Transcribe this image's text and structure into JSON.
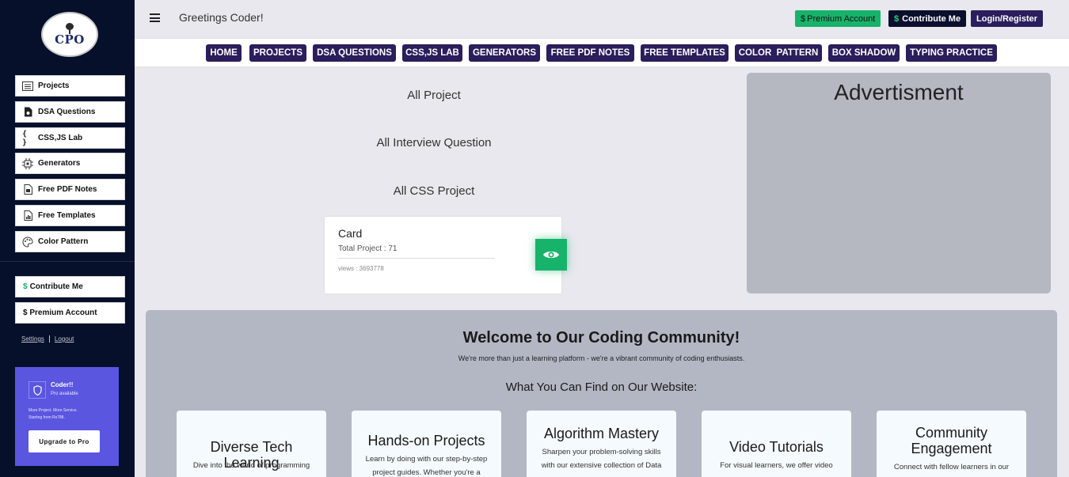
{
  "sidebar": {
    "logo_text": "CPO",
    "items": [
      {
        "label": "Projects",
        "icon": "list-icon"
      },
      {
        "label": "DSA Questions",
        "icon": "file-icon"
      },
      {
        "label": "CSS,JS Lab",
        "icon": "braces-icon"
      },
      {
        "label": "Generators",
        "icon": "chip-icon"
      },
      {
        "label": "Free PDF Notes",
        "icon": "pdf-icon"
      },
      {
        "label": "Free Templates",
        "icon": "template-icon"
      },
      {
        "label": "Color  Pattern",
        "icon": "palette-icon"
      }
    ],
    "contribute_label": "Contribute Me",
    "premium_label": "$ Premium Account",
    "settings_label": "Settings",
    "logout_label": "Logout",
    "promo": {
      "title": "Coder!!",
      "subtitle": "Pro available",
      "desc_line1": "More Project. More Service.",
      "desc_line2": "Starting from Rs788.",
      "button": "Upgrade to Pro"
    }
  },
  "header": {
    "greeting": "Greetings Coder!",
    "premium_label": "Premium Account",
    "contribute_label": "Contribute Me",
    "login_label": "Login/Register",
    "dollar": "$"
  },
  "nav": [
    "HOME",
    "PROJECTS",
    "DSA QUESTIONS",
    "CSS,JS LAB",
    "GENERATORS",
    "FREE PDF NOTES",
    "FREE TEMPLATES",
    "COLOR  PATTERN",
    "BOX SHADOW",
    "TYPING PRACTICE"
  ],
  "main": {
    "links": [
      "All Project",
      "All Interview Question",
      "All CSS Project"
    ],
    "card": {
      "title": "Card",
      "total": "Total Project : 71",
      "views": "views : 3693778"
    },
    "ad_title": "Advertisment"
  },
  "community": {
    "title": "Welcome to Our Coding Community!",
    "subtitle": "We're more than just a learning platform - we're a vibrant community of coding enthusiasts.",
    "find_title": "What You Can Find on Our Website:",
    "features": [
      {
        "title": "Diverse Tech Learning",
        "desc": "Dive into the world of programming"
      },
      {
        "title": "Hands-on Projects",
        "desc1": "Learn by doing with our step-by-step",
        "desc2": "project guides. Whether you're a"
      },
      {
        "title": "Algorithm Mastery",
        "desc1": "Sharpen your problem-solving skills",
        "desc2": "with our extensive collection of Data"
      },
      {
        "title": "Video Tutorials",
        "desc": "For visual learners, we offer video"
      },
      {
        "title": "Community Engagement",
        "desc": "Connect with fellow learners in our"
      }
    ]
  },
  "colors": {
    "sidebar_bg": "#06102b",
    "nav_button": "#2a1e5c",
    "accent_green": "#17b36b",
    "promo_bg": "#5a56e0"
  }
}
